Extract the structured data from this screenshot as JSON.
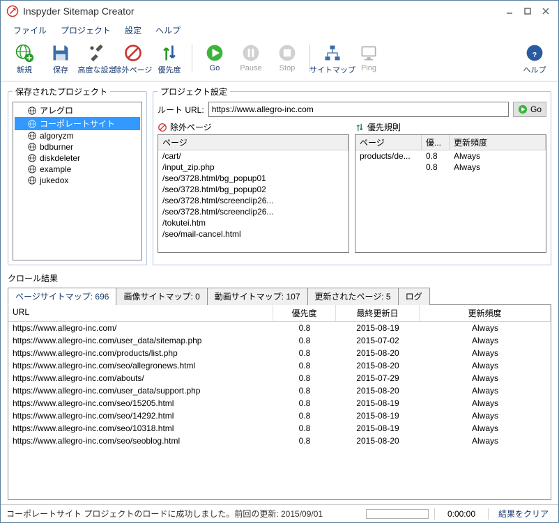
{
  "title": "Inspyder Sitemap Creator",
  "menu": {
    "file": "ファイル",
    "project": "プロジェクト",
    "settings": "設定",
    "help": "ヘルプ"
  },
  "toolbar": {
    "new": "新規",
    "save": "保存",
    "advanced": "高度な設定",
    "exclude": "除外ページ",
    "priority": "優先度",
    "go": "Go",
    "pause": "Pause",
    "stop": "Stop",
    "sitemap": "サイトマップ",
    "ping": "Ping",
    "help": "ヘルプ"
  },
  "saved_projects": {
    "title": "保存されたプロジェクト",
    "items": [
      "アレグロ",
      "コーポレートサイト",
      "algoryzm",
      "bdburner",
      "diskdeleter",
      "example",
      "jukedox"
    ],
    "selected_index": 1
  },
  "project_settings": {
    "title": "プロジェクト設定",
    "root_url_label": "ルート URL:",
    "root_url_value": "https://www.allegro-inc.com",
    "go_label": "Go"
  },
  "exclude_panel": {
    "title": "除外ページ",
    "col_page": "ページ",
    "items": [
      "/cart/",
      "/input_zip.php",
      "/seo/3728.html/bg_popup01",
      "/seo/3728.html/bg_popup02",
      "/seo/3728.html/screenclip26...",
      "/seo/3728.html/screenclip26...",
      "/tokutei.htm",
      "/seo/mail-cancel.html"
    ]
  },
  "priority_panel": {
    "title": "優先規則",
    "col_page": "ページ",
    "col_pri": "優...",
    "col_freq": "更新頻度",
    "rows": [
      {
        "page": "products/de...",
        "pri": "0.8",
        "freq": "Always"
      },
      {
        "page": "",
        "pri": "0.8",
        "freq": "Always"
      }
    ]
  },
  "crawl": {
    "title": "クロール結果",
    "tabs": {
      "page": "ページサイトマップ: 696",
      "image": "画像サイトマップ: 0",
      "video": "動画サイトマップ: 107",
      "updated": "更新されたページ: 5",
      "log": "ログ"
    },
    "cols": {
      "url": "URL",
      "pri": "優先度",
      "mod": "最終更新日",
      "freq": "更新頻度"
    },
    "rows": [
      {
        "url": "https://www.allegro-inc.com/",
        "pri": "0.8",
        "mod": "2015-08-19",
        "freq": "Always"
      },
      {
        "url": "https://www.allegro-inc.com/user_data/sitemap.php",
        "pri": "0.8",
        "mod": "2015-07-02",
        "freq": "Always"
      },
      {
        "url": "https://www.allegro-inc.com/products/list.php",
        "pri": "0.8",
        "mod": "2015-08-20",
        "freq": "Always"
      },
      {
        "url": "https://www.allegro-inc.com/seo/allegronews.html",
        "pri": "0.8",
        "mod": "2015-08-20",
        "freq": "Always"
      },
      {
        "url": "https://www.allegro-inc.com/abouts/",
        "pri": "0.8",
        "mod": "2015-07-29",
        "freq": "Always"
      },
      {
        "url": "https://www.allegro-inc.com/user_data/support.php",
        "pri": "0.8",
        "mod": "2015-08-20",
        "freq": "Always"
      },
      {
        "url": "https://www.allegro-inc.com/seo/15205.html",
        "pri": "0.8",
        "mod": "2015-08-19",
        "freq": "Always"
      },
      {
        "url": "https://www.allegro-inc.com/seo/14292.html",
        "pri": "0.8",
        "mod": "2015-08-19",
        "freq": "Always"
      },
      {
        "url": "https://www.allegro-inc.com/seo/10318.html",
        "pri": "0.8",
        "mod": "2015-08-19",
        "freq": "Always"
      },
      {
        "url": "https://www.allegro-inc.com/seo/seoblog.html",
        "pri": "0.8",
        "mod": "2015-08-20",
        "freq": "Always"
      }
    ]
  },
  "statusbar": {
    "text": "コーポレートサイト プロジェクトのロードに成功しました。前回の更新: 2015/09/01",
    "time": "0:00:00",
    "clear": "結果をクリア"
  }
}
